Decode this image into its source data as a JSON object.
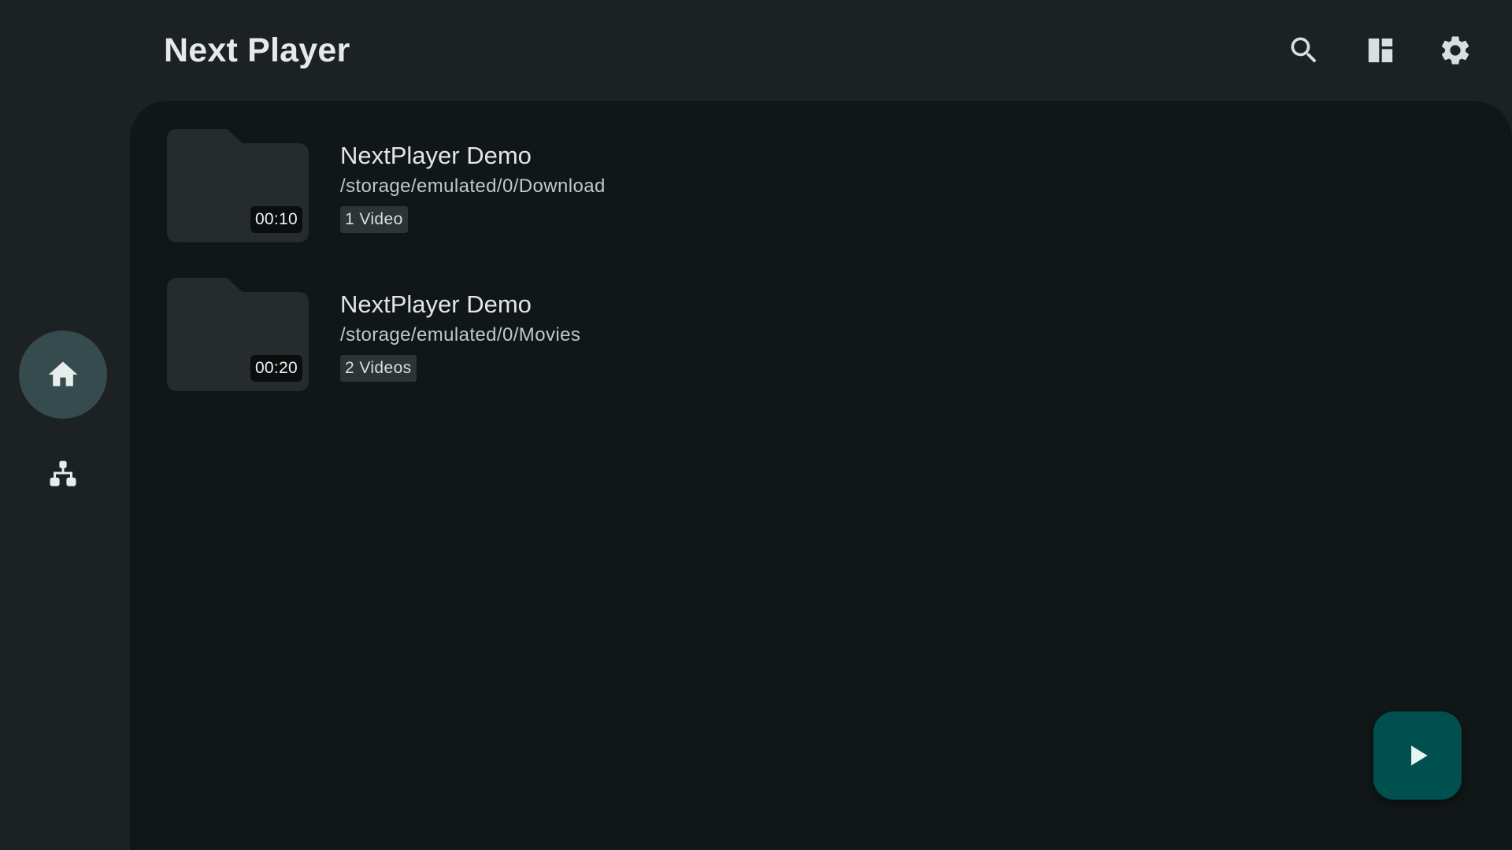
{
  "app": {
    "title": "Next Player"
  },
  "nav_rail": {
    "items": [
      {
        "name": "home",
        "icon": "home-icon",
        "active": true
      },
      {
        "name": "file-tree",
        "icon": "file-tree-icon",
        "active": false
      }
    ]
  },
  "toolbar": {
    "actions": [
      {
        "name": "search",
        "icon": "search-icon"
      },
      {
        "name": "layout",
        "icon": "dashboard-icon"
      },
      {
        "name": "settings",
        "icon": "gear-icon"
      }
    ]
  },
  "folders": [
    {
      "name": "NextPlayer Demo",
      "path": "/storage/emulated/0/Download",
      "count": "1 Video",
      "duration": "00:10"
    },
    {
      "name": "NextPlayer Demo",
      "path": "/storage/emulated/0/Movies",
      "count": "2 Videos",
      "duration": "00:20"
    }
  ],
  "fab": {
    "icon": "play-icon"
  },
  "colors": {
    "background": "#1c2123",
    "surface": "#111617",
    "rail_active": "#364b4d",
    "fab": "#00504f",
    "folder": "#262b2c"
  }
}
